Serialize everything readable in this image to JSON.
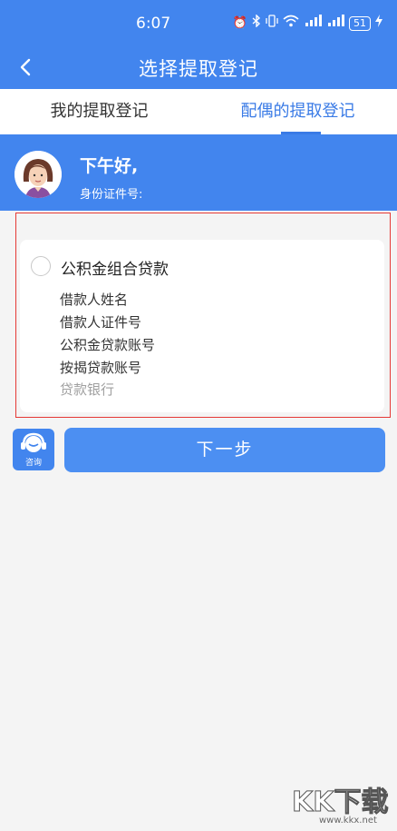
{
  "status_bar": {
    "time": "6:07",
    "battery": "51",
    "icons": [
      "alarm-icon",
      "bluetooth-icon",
      "vibrate-icon",
      "wifi-icon",
      "signal-1-icon",
      "signal-2-icon",
      "charging-icon"
    ]
  },
  "header": {
    "title": "选择提取登记"
  },
  "tabs": [
    {
      "label": "我的提取登记",
      "active": false
    },
    {
      "label": "配偶的提取登记",
      "active": true
    }
  ],
  "user": {
    "greeting": "下午好,",
    "id_label": "身份证件号:"
  },
  "loan_card": {
    "title": "公积金组合贷款",
    "fields": [
      "借款人姓名",
      "借款人证件号",
      "公积金贷款账号",
      "按揭贷款账号",
      "贷款银行"
    ]
  },
  "actions": {
    "consult_label": "咨询",
    "next_label": "下一步"
  },
  "watermark": {
    "brand": "KK下载",
    "url": "www.kkx.net"
  },
  "colors": {
    "primary": "#4285ee",
    "tab_active": "#3a7be6",
    "frame_red": "#e53935",
    "background": "#f4f4f4"
  }
}
